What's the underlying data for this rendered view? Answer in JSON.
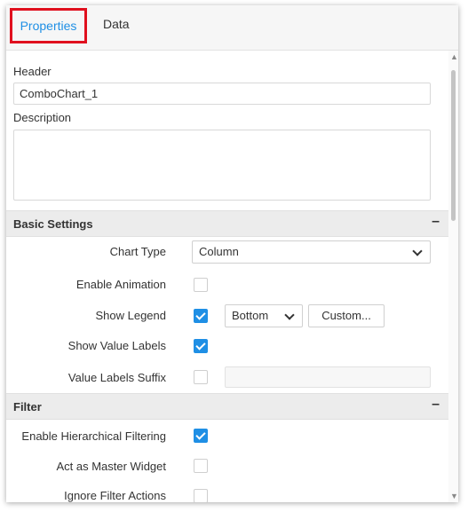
{
  "tabs": {
    "properties": "Properties",
    "data": "Data"
  },
  "general": {
    "header_label": "Header",
    "header_value": "ComboChart_1",
    "description_label": "Description",
    "description_value": ""
  },
  "basic_settings": {
    "title": "Basic Settings",
    "collapse_symbol": "–",
    "chart_type_label": "Chart Type",
    "chart_type_value": "Column",
    "enable_animation_label": "Enable Animation",
    "enable_animation_checked": false,
    "show_legend_label": "Show Legend",
    "show_legend_checked": true,
    "legend_position_value": "Bottom",
    "custom_button_label": "Custom...",
    "show_value_labels_label": "Show Value Labels",
    "show_value_labels_checked": true,
    "value_labels_suffix_label": "Value Labels Suffix",
    "value_labels_suffix_checked": false,
    "value_labels_suffix_value": ""
  },
  "filter": {
    "title": "Filter",
    "collapse_symbol": "–",
    "hierarchical_label": "Enable Hierarchical Filtering",
    "hierarchical_checked": true,
    "master_widget_label": "Act as Master Widget",
    "master_widget_checked": false,
    "ignore_filter_label": "Ignore Filter Actions",
    "ignore_filter_checked": false
  },
  "colors": {
    "accent": "#1f8fe5",
    "highlight_border": "#e0101e"
  }
}
